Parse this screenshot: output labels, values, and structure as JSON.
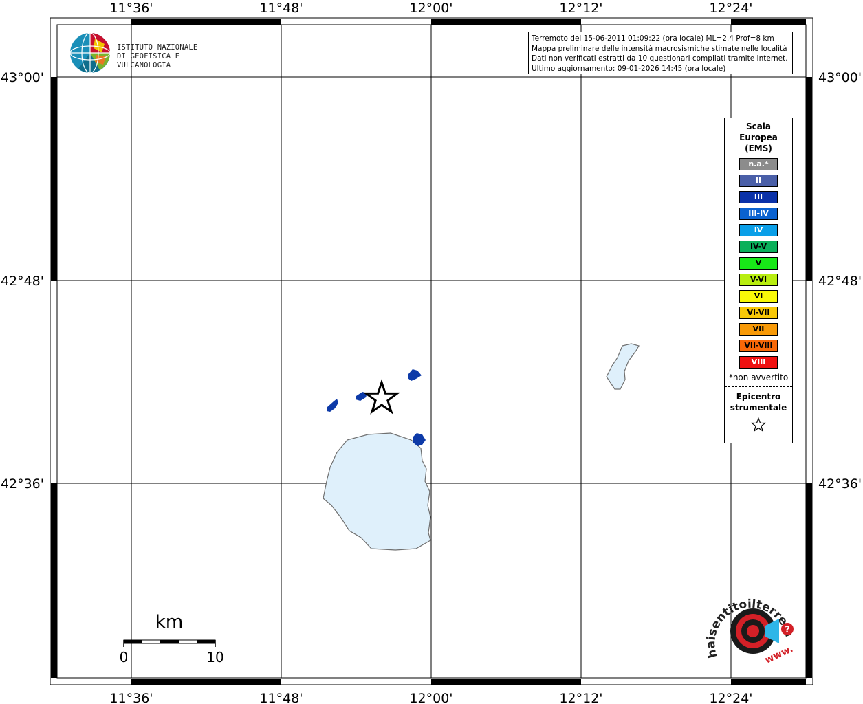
{
  "map": {
    "lon_labels": [
      "11°36'",
      "11°48'",
      "12°00'",
      "12°12'",
      "12°24'"
    ],
    "lat_labels": [
      "43°00'",
      "42°48'",
      "42°36'"
    ],
    "colors": {
      "lake": "#dff0fb",
      "lake_stroke": "#6f6f6f",
      "locality": "#0d3aa8"
    }
  },
  "info": {
    "line1": "Terremoto del 15-06-2011 01:09:22 (ora locale) ML=2.4 Prof=8 km",
    "line2": "Mappa preliminare delle intensità macrosismiche stimate nelle località",
    "line3": "Dati non verificati estratti da 10 questionari compilati tramite Internet.",
    "line4": "Ultimo aggiornamento: 09-01-2026 14:45 (ora locale)"
  },
  "logo": {
    "line1": "ISTITUTO NAZIONALE",
    "line2": "DI GEOFISICA E VULCANOLOGIA"
  },
  "legend": {
    "title1": "Scala",
    "title2": "Europea",
    "title3": "(EMS)",
    "items": [
      {
        "label": "n.a.*",
        "color": "#8c8c8c",
        "text_color": "#ffffff"
      },
      {
        "label": "II",
        "color": "#4a5fa8",
        "text_color": "#ffffff"
      },
      {
        "label": "III",
        "color": "#0a31a8",
        "text_color": "#ffffff"
      },
      {
        "label": "III-IV",
        "color": "#0a62d0",
        "text_color": "#ffffff"
      },
      {
        "label": "IV",
        "color": "#0a9fe8",
        "text_color": "#ffffff"
      },
      {
        "label": "IV-V",
        "color": "#0ab05a",
        "text_color": "#000000"
      },
      {
        "label": "V",
        "color": "#18e818",
        "text_color": "#000000"
      },
      {
        "label": "V-VI",
        "color": "#b8ee10",
        "text_color": "#000000"
      },
      {
        "label": "VI",
        "color": "#f8f808",
        "text_color": "#000000"
      },
      {
        "label": "VI-VII",
        "color": "#f8c808",
        "text_color": "#000000"
      },
      {
        "label": "VII",
        "color": "#f89a08",
        "text_color": "#000000"
      },
      {
        "label": "VII-VIII",
        "color": "#f86808",
        "text_color": "#000000"
      },
      {
        "label": "VIII",
        "color": "#f01010",
        "text_color": "#ffffff"
      }
    ],
    "note": "*non avvertito",
    "epicentre1": "Epicentro",
    "epicentre2": "strumentale"
  },
  "scalebar": {
    "unit": "km",
    "min": "0",
    "max": "10"
  },
  "hsit": {
    "brand": "haisentitoilterremoto.it",
    "prefix": "www."
  }
}
